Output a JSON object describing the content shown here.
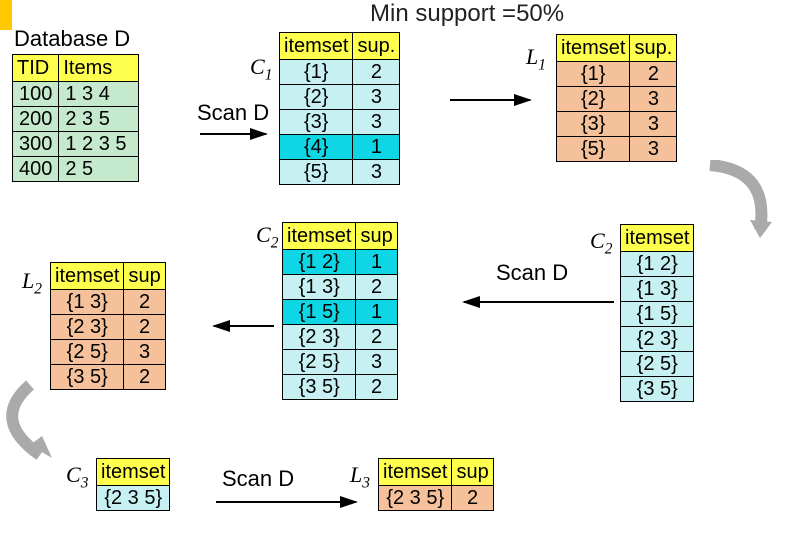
{
  "title": "Min support =50%",
  "db_label": "Database D",
  "scan_label": "Scan D",
  "headers": {
    "tid": "TID",
    "items": "Items",
    "itemset": "itemset",
    "sup_dot": "sup.",
    "sup": "sup"
  },
  "labels": {
    "C1": "C",
    "C1s": "1",
    "L1": "L",
    "L1s": "1",
    "C2": "C",
    "C2s": "2",
    "L2": "L",
    "L2s": "2",
    "C3": "C",
    "C3s": "3",
    "L3": "L",
    "L3s": "3"
  },
  "D": [
    {
      "tid": "100",
      "items": "1 3 4"
    },
    {
      "tid": "200",
      "items": "2 3 5"
    },
    {
      "tid": "300",
      "items": "1 2 3 5"
    },
    {
      "tid": "400",
      "items": "2 5"
    }
  ],
  "C1": [
    {
      "set": "{1}",
      "sup": "2",
      "hi": false
    },
    {
      "set": "{2}",
      "sup": "3",
      "hi": false
    },
    {
      "set": "{3}",
      "sup": "3",
      "hi": false
    },
    {
      "set": "{4}",
      "sup": "1",
      "hi": true
    },
    {
      "set": "{5}",
      "sup": "3",
      "hi": false
    }
  ],
  "L1": [
    {
      "set": "{1}",
      "sup": "2"
    },
    {
      "set": "{2}",
      "sup": "3"
    },
    {
      "set": "{3}",
      "sup": "3"
    },
    {
      "set": "{5}",
      "sup": "3"
    }
  ],
  "C2cand": [
    "{1 2}",
    "{1 3}",
    "{1 5}",
    "{2 3}",
    "{2 5}",
    "{3 5}"
  ],
  "C2scan": [
    {
      "set": "{1 2}",
      "sup": "1",
      "hi": true
    },
    {
      "set": "{1 3}",
      "sup": "2",
      "hi": false
    },
    {
      "set": "{1 5}",
      "sup": "1",
      "hi": true
    },
    {
      "set": "{2 3}",
      "sup": "2",
      "hi": false
    },
    {
      "set": "{2 5}",
      "sup": "3",
      "hi": false
    },
    {
      "set": "{3 5}",
      "sup": "2",
      "hi": false
    }
  ],
  "L2": [
    {
      "set": "{1 3}",
      "sup": "2"
    },
    {
      "set": "{2 3}",
      "sup": "2"
    },
    {
      "set": "{2 5}",
      "sup": "3"
    },
    {
      "set": "{3 5}",
      "sup": "2"
    }
  ],
  "C3": [
    {
      "set": "{2 3 5}"
    }
  ],
  "L3": [
    {
      "set": "{2 3 5}",
      "sup": "2"
    }
  ]
}
